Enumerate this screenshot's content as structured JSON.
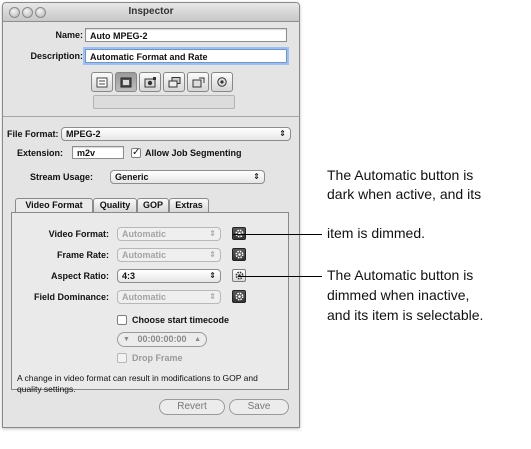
{
  "window": {
    "title": "Inspector"
  },
  "preset": {
    "name_label": "Name:",
    "name_value": "Auto MPEG-2",
    "description_label": "Description:",
    "description_value": "Automatic Format and Rate",
    "icons": [
      "summary-icon",
      "encoder-icon",
      "frame-controls-icon",
      "filters-icon",
      "geometry-icon",
      "actions-icon"
    ],
    "pane_label": "Encoder"
  },
  "encoder": {
    "file_format_label": "File Format:",
    "file_format_value": "MPEG-2",
    "extension_label": "Extension:",
    "extension_value": "m2v",
    "allow_segmenting_label": "Allow Job Segmenting",
    "allow_segmenting_checked": true,
    "stream_usage_label": "Stream Usage:",
    "stream_usage_value": "Generic"
  },
  "tabs": [
    {
      "label": "Video Format",
      "active": true
    },
    {
      "label": "Quality",
      "active": false
    },
    {
      "label": "GOP",
      "active": false
    },
    {
      "label": "Extras",
      "active": false
    }
  ],
  "video_format": {
    "rows": [
      {
        "label": "Video Format:",
        "value": "Automatic",
        "dimmed": true,
        "automatic_active": true
      },
      {
        "label": "Frame Rate:",
        "value": "Automatic",
        "dimmed": true,
        "automatic_active": true
      },
      {
        "label": "Aspect Ratio:",
        "value": "4:3",
        "dimmed": false,
        "automatic_active": false
      },
      {
        "label": "Field Dominance:",
        "value": "Automatic",
        "dimmed": true,
        "automatic_active": true
      }
    ],
    "choose_timecode_label": "Choose start timecode",
    "timecode_value": "00:00:00:00",
    "drop_frame_label": "Drop Frame",
    "note": "A change in video format can result in modifications to GOP and quality settings."
  },
  "footer": {
    "revert_label": "Revert",
    "save_label": "Save"
  },
  "annotations": {
    "active": [
      "The Automatic button is",
      "dark when active, and its",
      "item is dimmed."
    ],
    "inactive": [
      "The Automatic button is",
      "dimmed when inactive,",
      "and its item is selectable."
    ]
  },
  "colors": {
    "window_bg": "#e4e4e4",
    "focus_ring": "#9cc0f0",
    "active_gear": "#3a3a3a"
  }
}
